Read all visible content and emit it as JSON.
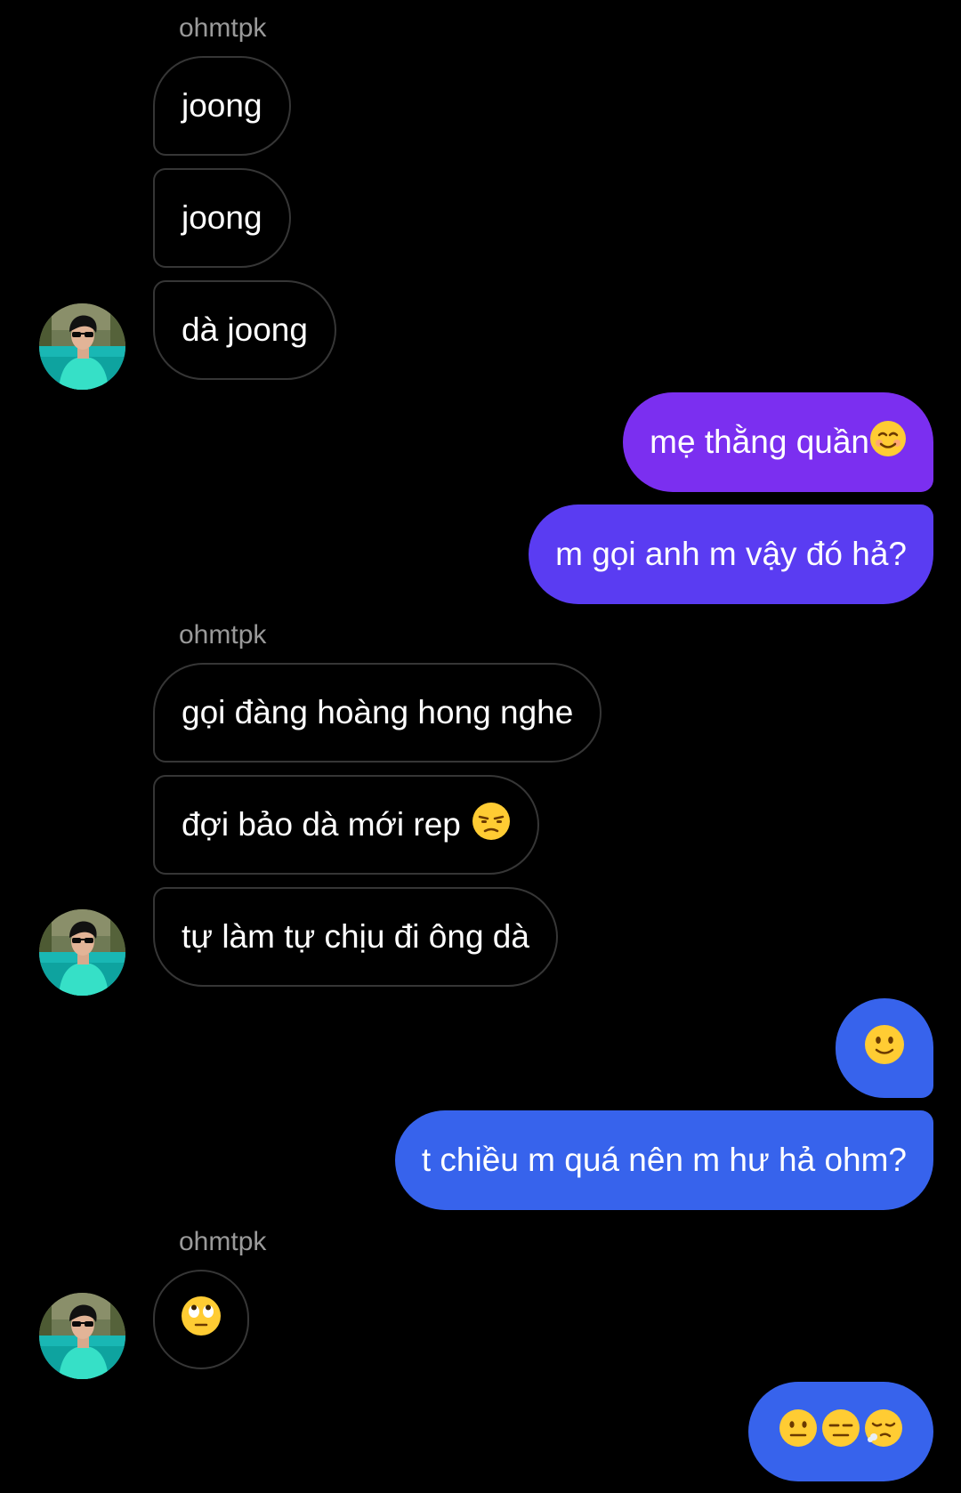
{
  "contact": {
    "name": "ohmtpk"
  },
  "colors": {
    "background": "#000000",
    "incoming_border": "#363636",
    "sender_label": "#9a9a9a",
    "outgoing_purple": "#7b2ff0",
    "outgoing_indigo": "#5a3cf2",
    "outgoing_blue": "#3763ec"
  },
  "messages": [
    {
      "direction": "incoming",
      "text": "joong"
    },
    {
      "direction": "incoming",
      "text": "joong"
    },
    {
      "direction": "incoming",
      "text": "dà joong"
    },
    {
      "direction": "outgoing",
      "text": "mẹ thằng quần",
      "emoji": "smiling-face-icon"
    },
    {
      "direction": "outgoing",
      "text": "m gọi anh m vậy đó hả?"
    },
    {
      "direction": "incoming",
      "text": "gọi đàng hoàng hong nghe"
    },
    {
      "direction": "incoming",
      "text": "đợi bảo dà mới rep",
      "emoji": "unamused-face-icon"
    },
    {
      "direction": "incoming",
      "text": "tự làm tự chịu đi ông dà"
    },
    {
      "direction": "outgoing",
      "text": "",
      "emoji": "slightly-smiling-face-icon"
    },
    {
      "direction": "outgoing",
      "text": "t chiều m quá nên m hư hả ohm?"
    },
    {
      "direction": "incoming",
      "text": "",
      "emoji": "eye-roll-face-icon"
    },
    {
      "direction": "outgoing",
      "text": "",
      "emoji": [
        "neutral-face-icon",
        "expressionless-face-icon",
        "exhaling-face-icon"
      ]
    }
  ]
}
